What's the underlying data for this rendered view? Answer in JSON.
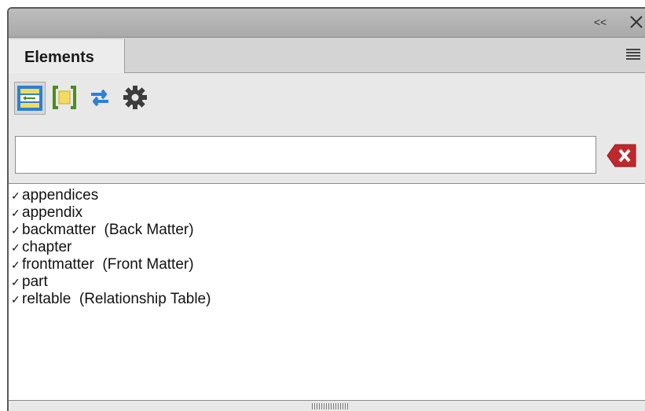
{
  "titlebar": {
    "collapse_label": "<<",
    "collapse_icon": "double-chevron-left-icon",
    "close_icon": "close-icon"
  },
  "tabs": [
    {
      "label": "Elements",
      "active": true
    }
  ],
  "panel_menu_icon": "hamburger-menu-icon",
  "toolbar": [
    {
      "name": "retag-icon",
      "active": true
    },
    {
      "name": "element-bracket-icon",
      "active": false
    },
    {
      "name": "swap-arrows-icon",
      "active": false
    },
    {
      "name": "settings-gear-icon",
      "active": false
    }
  ],
  "search": {
    "value": "",
    "placeholder": ""
  },
  "clear_icon": "clear-x-icon",
  "elements": [
    {
      "label": "appendices",
      "checked": true
    },
    {
      "label": "appendix",
      "checked": true
    },
    {
      "label": "backmatter  (Back Matter)",
      "checked": true
    },
    {
      "label": "chapter",
      "checked": true
    },
    {
      "label": "frontmatter  (Front Matter)",
      "checked": true
    },
    {
      "label": "part",
      "checked": true
    },
    {
      "label": "reltable  (Relationship Table)",
      "checked": true
    }
  ],
  "check_glyph": "✓",
  "colors": {
    "accent_blue": "#2e7fd6",
    "accent_green": "#4a8f1d",
    "accent_yellow": "#f2dc5d",
    "clear_red": "#c0282c"
  }
}
